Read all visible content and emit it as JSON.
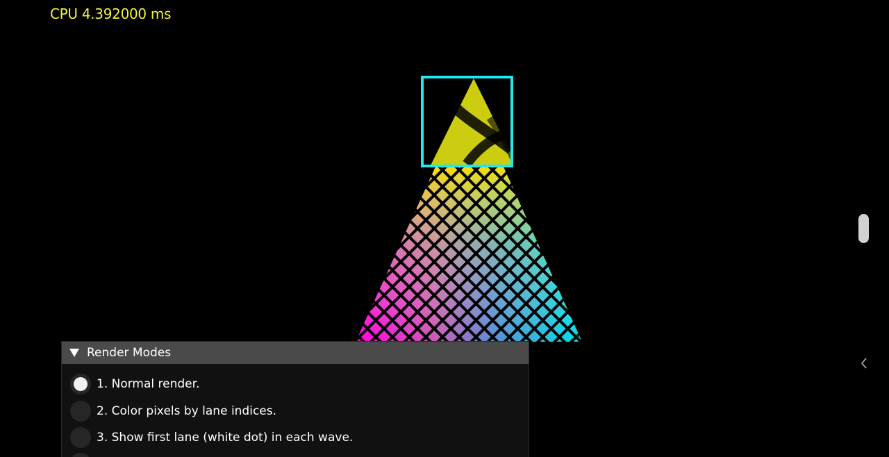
{
  "hud": {
    "cpu_time": "CPU 4.392000 ms",
    "cpu_color": "#f2f23c"
  },
  "scene": {
    "highlight_color": "#22e6f0",
    "zoom_fill_color": "#cccc10"
  },
  "render_modes": {
    "title": "Render Modes",
    "expanded": true,
    "options": [
      {
        "label": "1. Normal render.",
        "selected": true
      },
      {
        "label": "2. Color pixels by lane indices.",
        "selected": false
      },
      {
        "label": "3. Show first lane (white dot) in each wave.",
        "selected": false
      },
      {
        "label": "",
        "selected": false
      }
    ]
  },
  "sidebar": {
    "collapse_icon": "chevron-left-icon"
  }
}
